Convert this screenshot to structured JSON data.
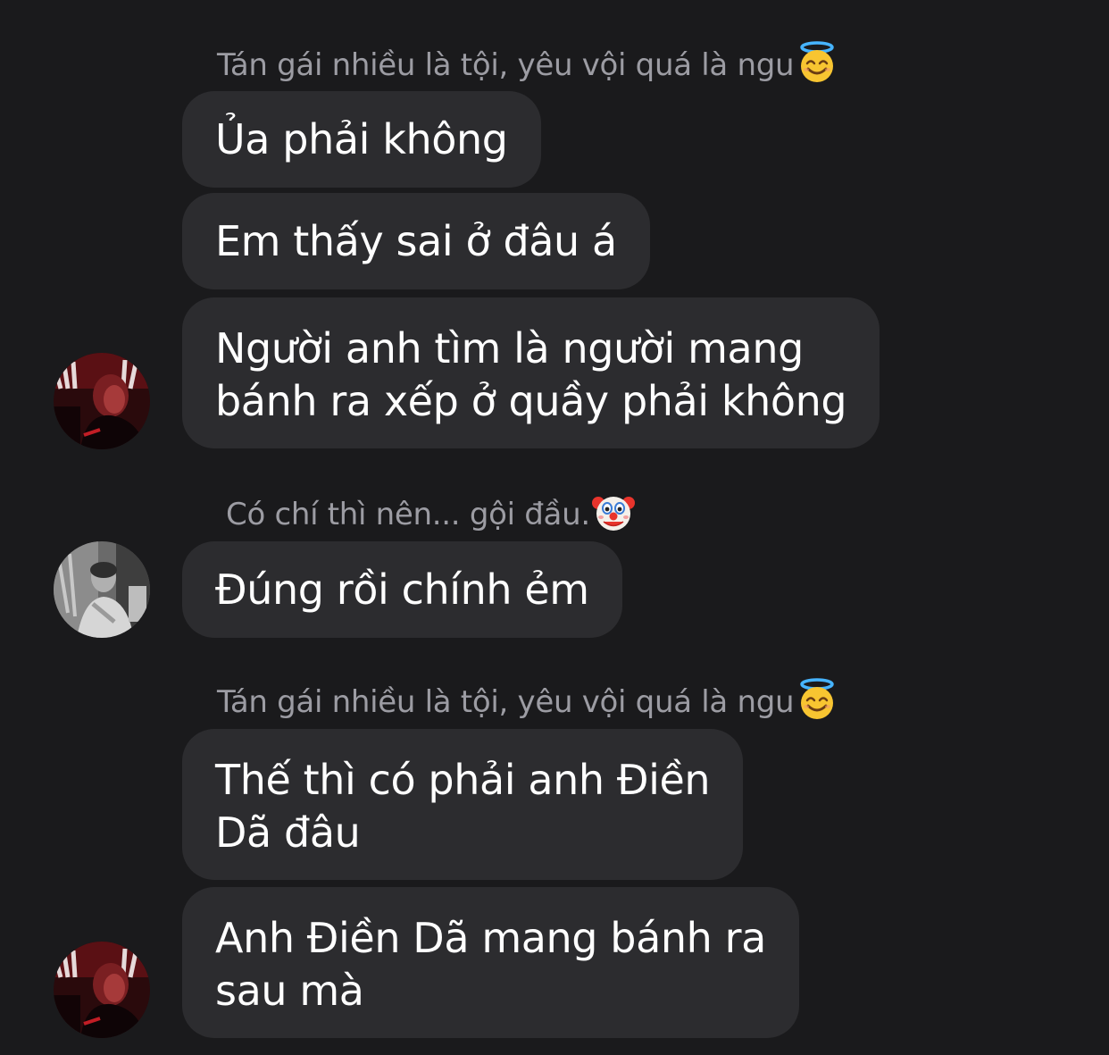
{
  "messages": [
    {
      "sender": "Tán gái nhiều là tội, yêu vội quá là ngu",
      "sender_icon": "halo-smile-emoji",
      "bubbles": [
        [
          "Ủa phải không"
        ],
        [
          "Em thấy sai ở đâu á"
        ],
        [
          "Người anh tìm là người mang",
          "bánh ra xếp ở quầy phải không"
        ]
      ],
      "avatar": "red-dark-portrait"
    },
    {
      "sender": "Có chí thì nên... gội đầu.",
      "sender_icon": "clown-face-emoji",
      "bubbles": [
        [
          "Đúng rồi chính ẻm"
        ]
      ],
      "avatar": "grayscale-portrait"
    },
    {
      "sender": "Tán gái nhiều là tội, yêu vội quá là ngu",
      "sender_icon": "halo-smile-emoji",
      "bubbles": [
        [
          "Thế thì có phải anh Điền",
          "Dã đâu"
        ],
        [
          "Anh Điền Dã mang bánh ra",
          "sau mà"
        ]
      ],
      "avatar": "red-dark-portrait"
    }
  ],
  "colors": {
    "background": "#1a1a1c",
    "bubble": "#2c2c2f",
    "sender_name": "#9c9ca3",
    "text": "#ffffff"
  }
}
